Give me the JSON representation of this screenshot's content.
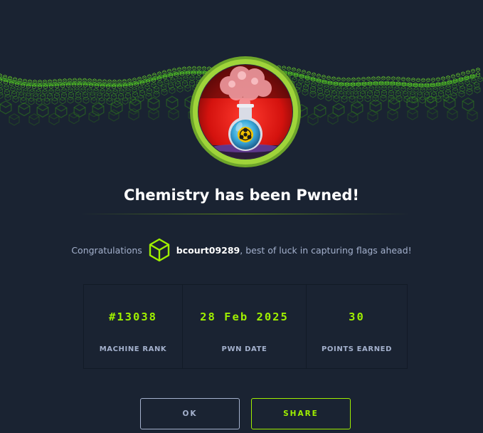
{
  "modal": {
    "title": "Chemistry has been Pwned!",
    "congrats_prefix": "Congratulations",
    "username": "bcourt09289",
    "congrats_suffix": ", best of luck in capturing flags ahead!"
  },
  "stats": [
    {
      "value": "#13038",
      "label": "MACHINE RANK"
    },
    {
      "value": "28 Feb 2025",
      "label": "PWN DATE"
    },
    {
      "value": "30",
      "label": "POINTS EARNED"
    }
  ],
  "buttons": {
    "ok": "OK",
    "share": "SHARE"
  },
  "icons": {
    "user_badge": "hackthebox-cube-icon",
    "machine_avatar": "flask-biohazard-icon"
  },
  "colors": {
    "background": "#1a2332",
    "accent": "#9fef00",
    "muted_text": "#a4b1cd",
    "title_text": "#ffffff"
  }
}
